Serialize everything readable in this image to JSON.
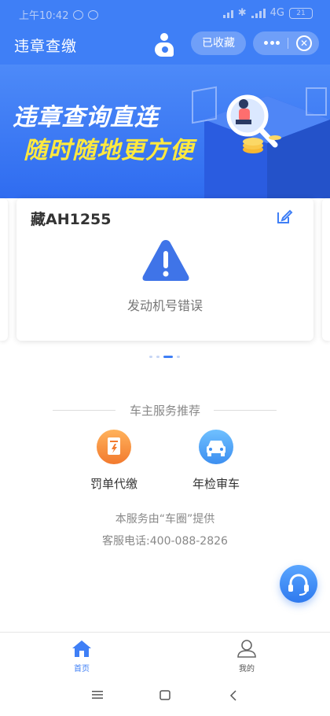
{
  "status_bar": {
    "time": "上午10:42",
    "network": "4G",
    "battery": "21"
  },
  "header": {
    "title": "违章查缴",
    "favorite_label": "已收藏"
  },
  "banner": {
    "line1": "违章查询直连",
    "line2": "随时随地更方便"
  },
  "card": {
    "plate": "藏AH1255",
    "error_message": "发动机号错误"
  },
  "services": {
    "section_title": "车主服务推荐",
    "items": [
      {
        "label": "罚单代缴",
        "icon": "ticket-icon"
      },
      {
        "label": "年检审车",
        "icon": "car-icon"
      }
    ]
  },
  "footer": {
    "provider_text": "本服务由“车圈”提供",
    "hotline": "客服电话:400-088-2826"
  },
  "tabs": [
    {
      "label": "首页",
      "icon": "home-icon",
      "active": true
    },
    {
      "label": "我的",
      "icon": "user-icon",
      "active": false
    }
  ],
  "colors": {
    "primary": "#3f7ff6",
    "warning_yellow": "#ffe93f",
    "orange": "#f27a2e"
  }
}
